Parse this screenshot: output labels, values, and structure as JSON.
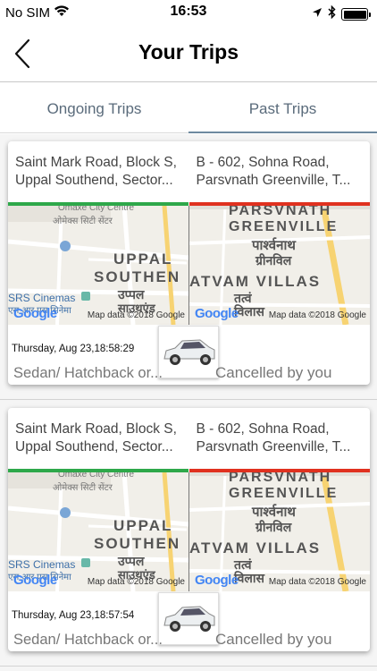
{
  "status_bar": {
    "carrier": "No SIM",
    "time": "16:53"
  },
  "nav": {
    "title": "Your Trips"
  },
  "tabs": [
    {
      "label": "Ongoing Trips",
      "active": false
    },
    {
      "label": "Past Trips",
      "active": true
    }
  ],
  "trips": [
    {
      "pickup_line1": "Saint Mark Road, Block S,",
      "pickup_line2": "Uppal Southend, Sector...",
      "drop_line1": "B - 602, Sohna Road,",
      "drop_line2": "Parsvnath Greenville, T...",
      "datetime": "Thursday, Aug 23,18:58:29",
      "car_type": "Sedan/ Hatchback or...",
      "status": "Cancelled by you"
    },
    {
      "pickup_line1": "Saint Mark Road, Block S,",
      "pickup_line2": "Uppal Southend, Sector...",
      "drop_line1": "B - 602, Sohna Road,",
      "drop_line2": "Parsvnath Greenville, T...",
      "datetime": "Thursday, Aug 23,18:57:54",
      "car_type": "Sedan/ Hatchback or...",
      "status": "Cancelled by you"
    }
  ],
  "map_left": {
    "area_en_1": "UPPAL",
    "area_en_2": "SOUTHEN",
    "area_hi": "उप्पल",
    "area_hi_2": "साउथएंड",
    "poi_en": "SRS Cinemas",
    "poi_hi": "एस आर एस सिनेमा",
    "top_en": "Omaxe City Centre",
    "top_hi": "ओमेक्स सिटी सेंटर",
    "map_data": "Map data ©2018 Google"
  },
  "map_right": {
    "area_en_1": "PARSVNATH",
    "area_en_2": "GREENVILLE",
    "area_hi_1": "पार्श्वनाथ",
    "area_hi_2": "ग्रीनविल",
    "area_en_3": "ATVAM VILLAS",
    "area_hi_3": "तत्वं",
    "area_hi_4": "विलास",
    "map_data": "Map data ©2018 Google"
  },
  "google_logo": "Google",
  "colors": {
    "pickup_bar": "#2ea84a",
    "drop_bar": "#e0311f",
    "tab_underline": "#6e8aa0"
  },
  "icons": [
    "wifi-icon",
    "location-arrow-icon",
    "bluetooth-icon",
    "battery-icon",
    "back-chevron-icon",
    "car-thumbnail-icon"
  ]
}
